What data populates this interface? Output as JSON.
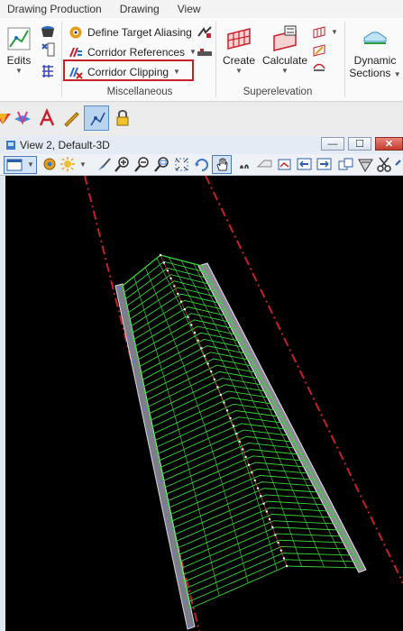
{
  "ribbon_tabs": [
    "Drawing Production",
    "Drawing",
    "View"
  ],
  "ribbon": {
    "edits_label": "Edits",
    "misc_items": [
      "Define Target Aliasing",
      "Corridor References",
      "Corridor Clipping"
    ],
    "misc_group_label": "Miscellaneous",
    "create_label": "Create",
    "calculate_label": "Calculate",
    "super_group_label": "Superelevation",
    "dynamic_label_1": "Dynamic",
    "dynamic_label_2": "Sections"
  },
  "view_window": {
    "title": "View 2, Default-3D",
    "background_color": "#000000",
    "corridor_color": "#3ad63a",
    "edge_line_color": "#c8202a"
  },
  "colors": {
    "highlight": "#c8202a",
    "ribbon_bg": "#fafafa",
    "titlebar_bg": "#e4ebf5"
  }
}
